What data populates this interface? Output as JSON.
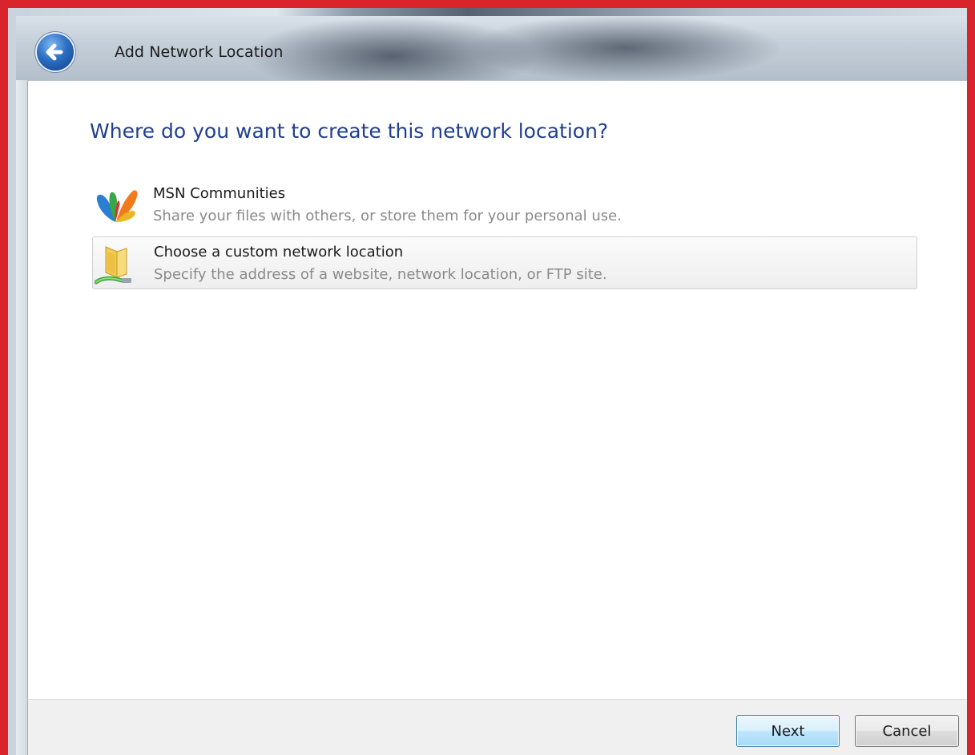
{
  "window": {
    "title": "Add Network Location"
  },
  "main": {
    "heading": "Where do you want to create this network location?",
    "options": [
      {
        "label": "MSN Communities",
        "description": "Share your files with others, or store them for your personal use.",
        "icon": "msn-butterfly-icon",
        "selected": false
      },
      {
        "label": "Choose a custom network location",
        "description": "Specify the address of a website, network location, or FTP site.",
        "icon": "network-folder-icon",
        "selected": true
      }
    ]
  },
  "footer": {
    "next_label": "Next",
    "cancel_label": "Cancel"
  },
  "colors": {
    "frame_border": "#d8242a",
    "heading": "#1f3f8f",
    "description": "#8a8a8a",
    "next_border": "#3c7fb1"
  }
}
